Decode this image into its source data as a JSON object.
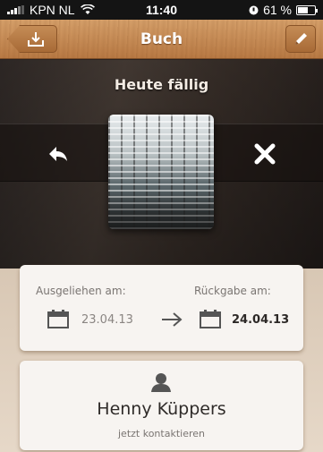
{
  "status_bar": {
    "carrier": "KPN NL",
    "time": "11:40",
    "battery": "61 %",
    "battery_level": 0.61
  },
  "nav": {
    "title": "Buch",
    "back_icon": "tray-download-icon",
    "edit_icon": "pencil-icon"
  },
  "banner": {
    "due_text": "Heute fällig",
    "return_icon": "reply-arrow-icon",
    "dismiss_icon": "close-icon"
  },
  "dates": {
    "borrowed_label": "Ausgeliehen am:",
    "borrowed_value": "23.04.13",
    "return_label": "Rückgabe am:",
    "return_value": "24.04.13"
  },
  "contact": {
    "name": "Henny Küppers",
    "action": "jetzt kontaktieren"
  },
  "colors": {
    "wood": "#c48c56",
    "card": "#f7f4f1",
    "icon": "#555555"
  }
}
